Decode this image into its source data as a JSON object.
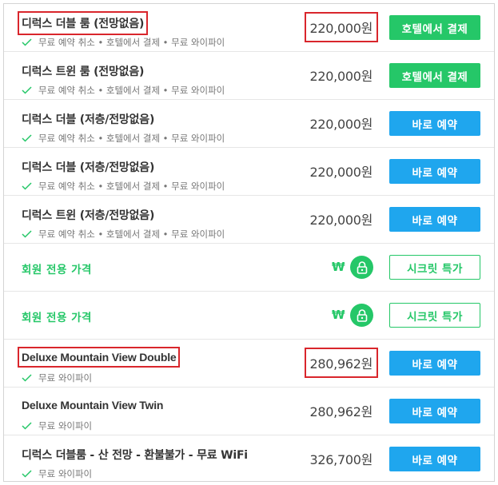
{
  "rooms": [
    {
      "name": "디럭스 더블 룸 (전망없음)",
      "amenities": "무료 예약 취소 • 호텔에서 결제 • 무료 와이파이",
      "price": "220,000원",
      "button": "호텔에서 결제"
    },
    {
      "name": "디럭스 트윈 룸 (전망없음)",
      "amenities": "무료 예약 취소 • 호텔에서 결제 • 무료 와이파이",
      "price": "220,000원",
      "button": "호텔에서 결제"
    },
    {
      "name": "디럭스 더블 (저층/전망없음)",
      "amenities": "무료 예약 취소 • 호텔에서 결제 • 무료 와이파이",
      "price": "220,000원",
      "button": "바로 예약"
    },
    {
      "name": "디럭스 더블 (저층/전망없음)",
      "amenities": "무료 예약 취소 • 호텔에서 결제 • 무료 와이파이",
      "price": "220,000원",
      "button": "바로 예약"
    },
    {
      "name": "디럭스 트윈 (저층/전망없음)",
      "amenities": "무료 예약 취소 • 호텔에서 결제 • 무료 와이파이",
      "price": "220,000원",
      "button": "바로 예약"
    }
  ],
  "member_rows": [
    {
      "label": "회원 전용 가격",
      "currency": "₩",
      "button": "시크릿 특가"
    },
    {
      "label": "회원 전용 가격",
      "currency": "₩",
      "button": "시크릿 특가"
    }
  ],
  "rooms_en": [
    {
      "name": "Deluxe Mountain View Double",
      "amenities": "무료 와이파이",
      "price": "280,962원",
      "button": "바로 예약"
    },
    {
      "name": "Deluxe Mountain View Twin",
      "amenities": "무료 와이파이",
      "price": "280,962원",
      "button": "바로 예약"
    },
    {
      "name": "디럭스 더블룸 - 산 전망 - 환불불가 - 무료 WiFi",
      "amenities": "무료 와이파이",
      "price": "326,700원",
      "button": "바로 예약"
    }
  ],
  "colors": {
    "green": "#25c768",
    "blue": "#1fa6ee",
    "highlight": "#d9262c"
  },
  "icons": {
    "amenity_check": "check-icon",
    "member_lock": "lock-icon"
  }
}
